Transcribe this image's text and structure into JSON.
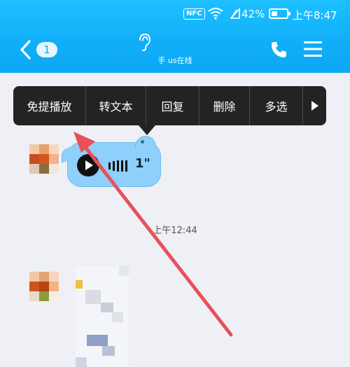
{
  "status_bar": {
    "nfc": "NFC",
    "battery_pct": "42%",
    "battery_level": 0.42,
    "clock": "上午8:47"
  },
  "title_bar": {
    "back_badge": "1",
    "contact_status": "手 us在线"
  },
  "context_menu": {
    "items": [
      "免提播放",
      "转文本",
      "回复",
      "删除",
      "多选"
    ]
  },
  "voice_message": {
    "duration": "1\""
  },
  "timestamp": "上午12:44",
  "colors": {
    "header": "#10aef8",
    "bubble": "#8ed0fb",
    "menu_bg": "#232323",
    "arrow": "#e8505a"
  }
}
